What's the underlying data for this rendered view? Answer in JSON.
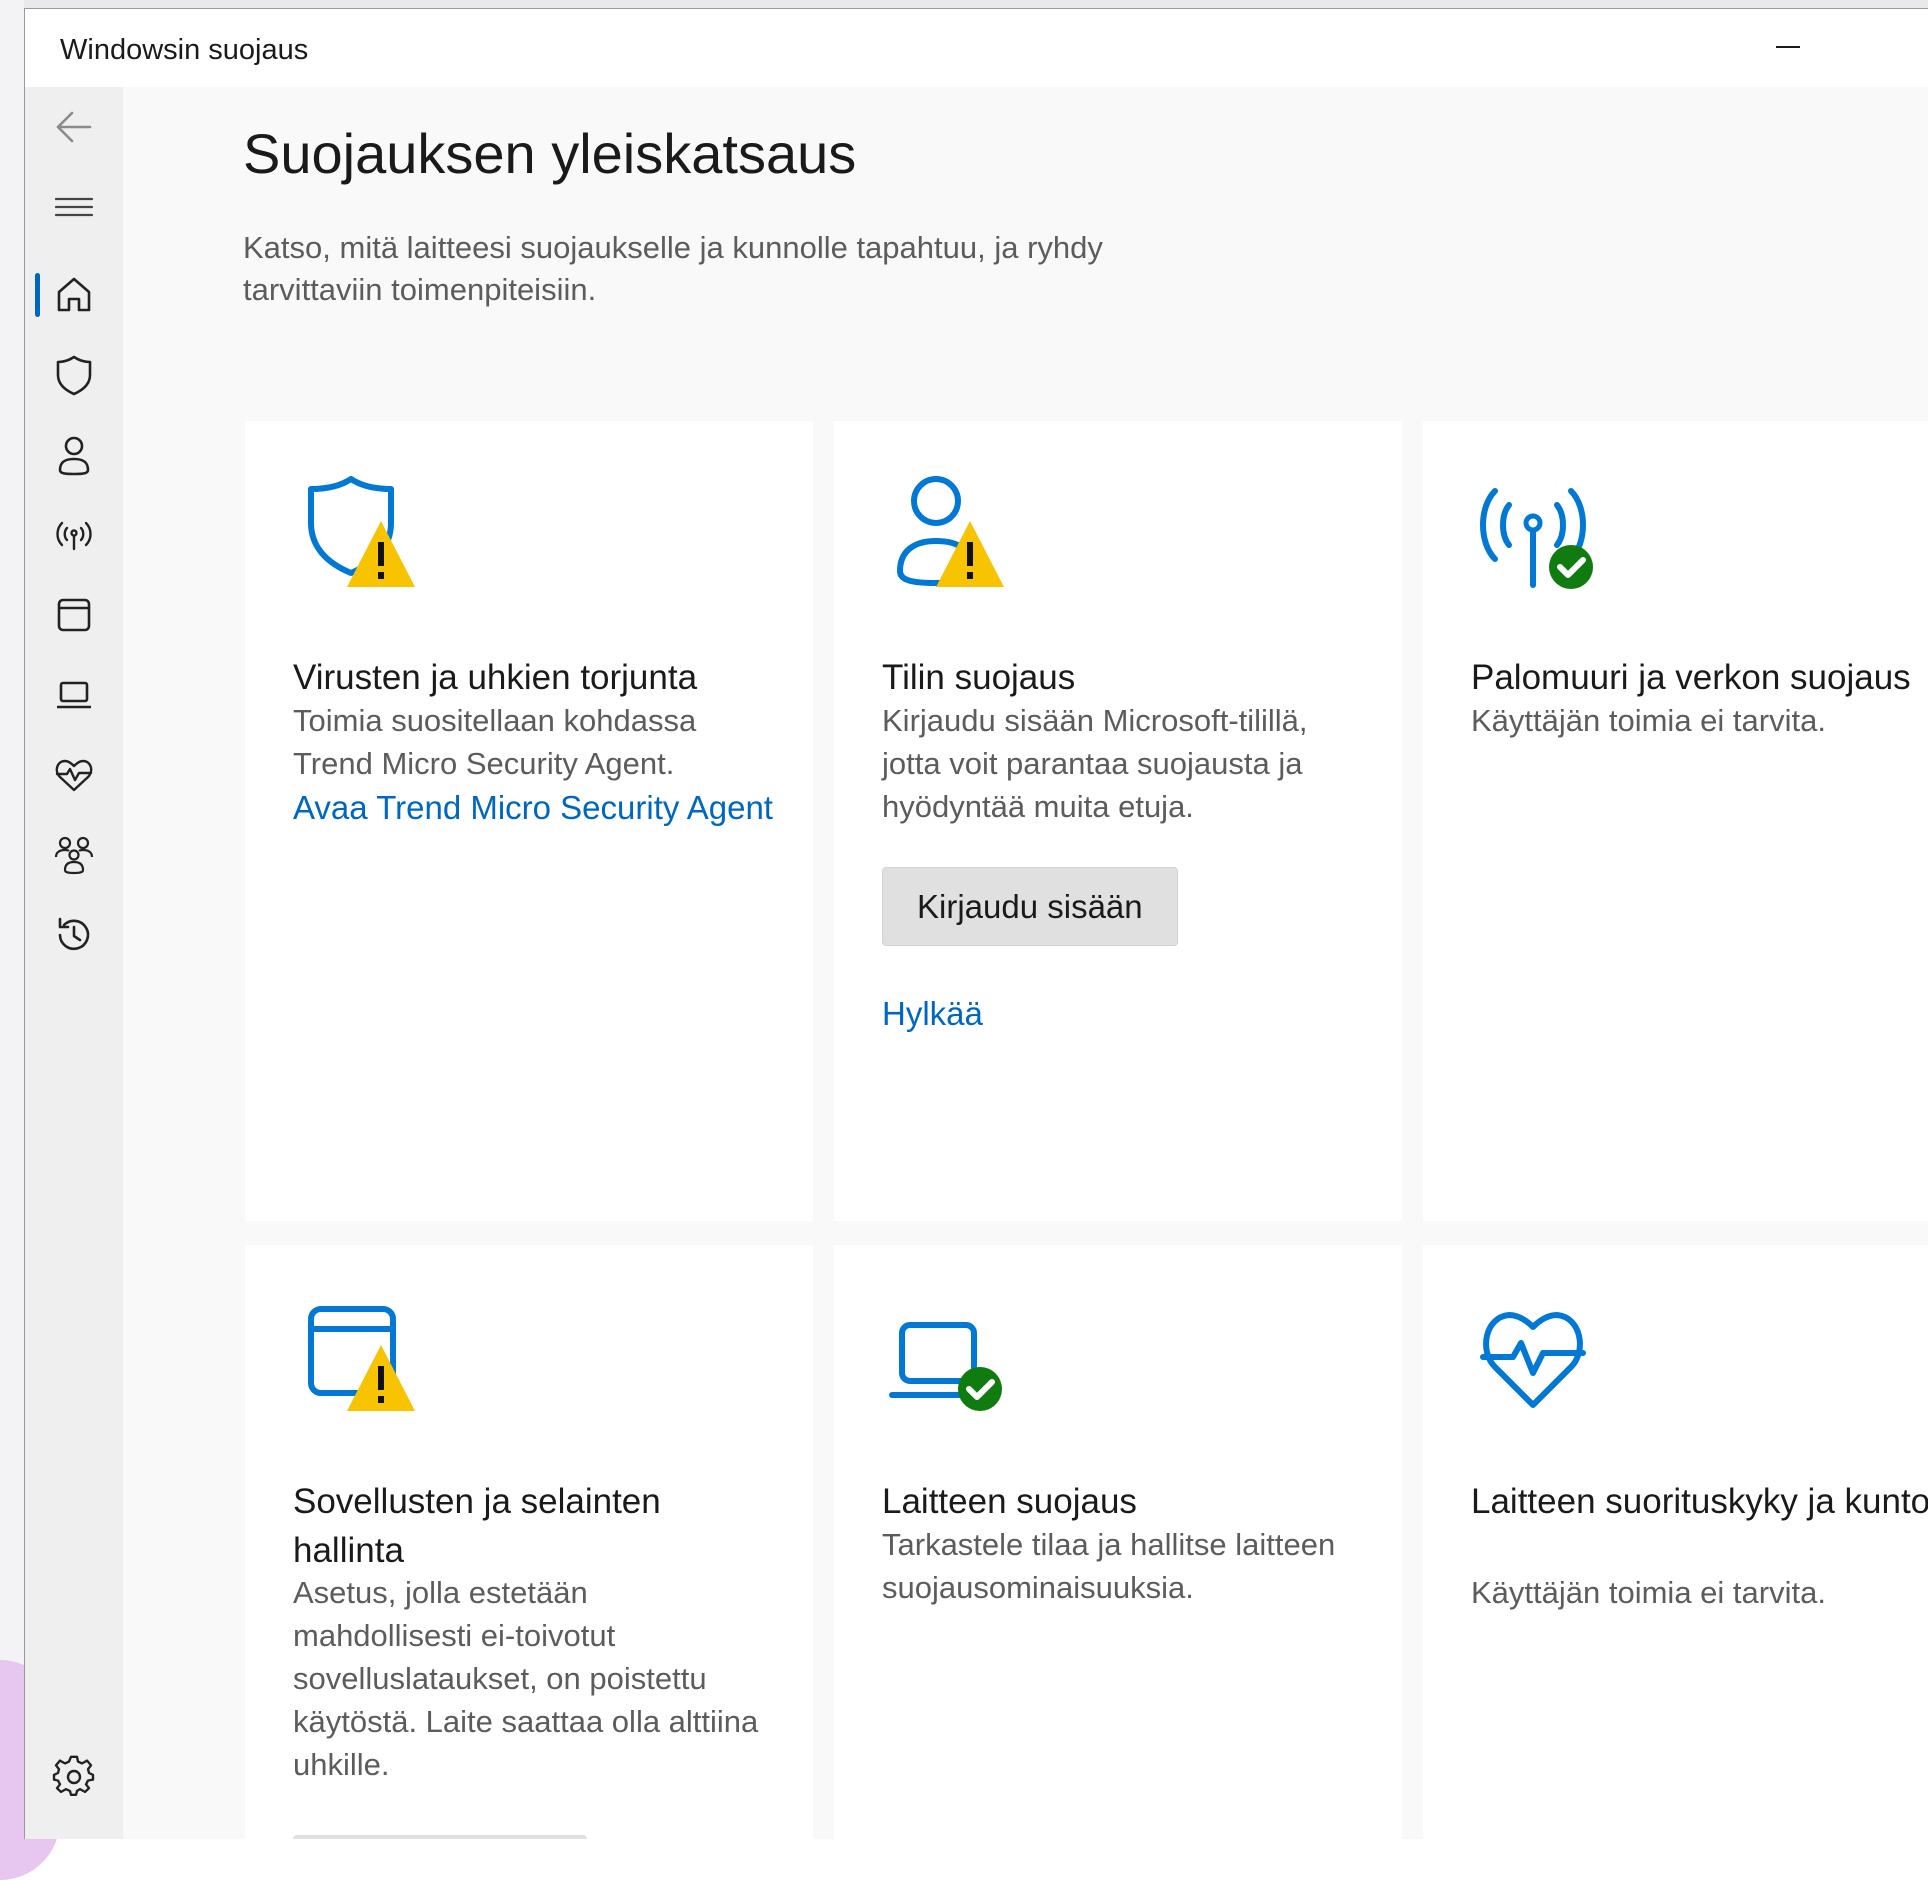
{
  "window": {
    "title": "Windowsin suojaus"
  },
  "page": {
    "title": "Suojauksen yleiskatsaus",
    "description": "Katso, mitä laitteesi suojaukselle ja kunnolle tapahtuu, ja ryhdy tarvittaviin toimenpiteisiin."
  },
  "sidebar": {
    "items": [
      {
        "icon": "back-arrow-icon"
      },
      {
        "icon": "menu-icon"
      },
      {
        "icon": "home-icon",
        "selected": true
      },
      {
        "icon": "shield-icon"
      },
      {
        "icon": "person-icon"
      },
      {
        "icon": "antenna-icon"
      },
      {
        "icon": "app-window-icon"
      },
      {
        "icon": "laptop-icon"
      },
      {
        "icon": "heart-pulse-icon"
      },
      {
        "icon": "family-icon"
      },
      {
        "icon": "history-icon"
      },
      {
        "icon": "gear-icon"
      }
    ]
  },
  "cards": {
    "virus": {
      "title": "Virusten ja uhkien torjunta",
      "description": "Toimia suositellaan kohdassa Trend Micro Security Agent.",
      "link": "Avaa Trend Micro Security Agent",
      "status": "warning"
    },
    "account": {
      "title": "Tilin suojaus",
      "description": "Kirjaudu sisään Microsoft-tilillä, jotta voit parantaa suojausta ja hyödyntää muita etuja.",
      "button": "Kirjaudu sisään",
      "link": "Hylkää",
      "status": "warning"
    },
    "firewall": {
      "title": "Palomuuri ja verkon suojaus",
      "description": "Käyttäjän toimia ei tarvita.",
      "status": "ok"
    },
    "app_browser": {
      "title": "Sovellusten ja selainten hallinta",
      "description": "Asetus, jolla estetään mahdollisesti ei-toivotut sovelluslataukset, on poistettu käytöstä. Laite saattaa olla alttiina uhkille.",
      "status": "warning"
    },
    "device_security": {
      "title": "Laitteen suojaus",
      "description": "Tarkastele tilaa ja hallitse laitteen suojausominaisuuksia.",
      "status": "ok"
    },
    "performance": {
      "title": "Laitteen suorituskyky ja kunto",
      "description": "Käyttäjän toimia ei tarvita."
    }
  },
  "colors": {
    "accent": "#0067c0",
    "warning": "#f8c300",
    "ok": "#107c10"
  }
}
